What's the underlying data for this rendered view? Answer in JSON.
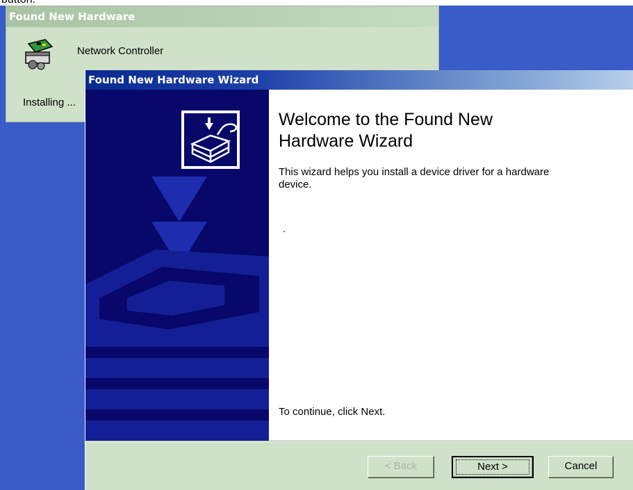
{
  "background_window": {
    "title": "Found New Hardware",
    "device_name": "Network Controller",
    "status_text": "Installing ..."
  },
  "wizard": {
    "title": "Found New Hardware Wizard",
    "heading": "Welcome to the Found New Hardware Wizard",
    "description": "This wizard helps you install a device driver for a hardware device.",
    "dot": ".",
    "continue_text": "To continue, click Next.",
    "buttons": {
      "back": "< Back",
      "next": "Next >",
      "cancel": "Cancel"
    }
  },
  "top_fragment": "button."
}
